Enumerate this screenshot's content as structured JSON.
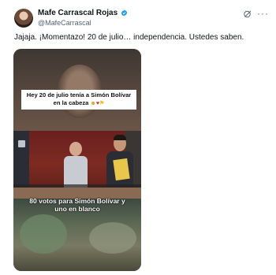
{
  "author": {
    "display_name": "Mafe Carrascal Rojas",
    "handle": "@MafeCarrascal"
  },
  "post": {
    "text": "Jajaja. ¡Momentazo! 20 de julio… independencia. Ustedes saben."
  },
  "media": {
    "top_caption": "Hey 20 de julio tenía a Simón Bolívar en la cabeza",
    "top_caption_emojis": [
      "laughing-face-emoji",
      "red-heart-emoji",
      "colombia-flag-emoji"
    ],
    "bottom_caption": "80 votos para Simón Bolívar y uno en blanco"
  },
  "colors": {
    "text": "#0f1419",
    "secondary_text": "#536471",
    "verified": "#1d9bf0",
    "chamber_red": "#7d2a22"
  },
  "icons": [
    "verified-badge-icon",
    "grok-icon",
    "more-options-icon"
  ]
}
